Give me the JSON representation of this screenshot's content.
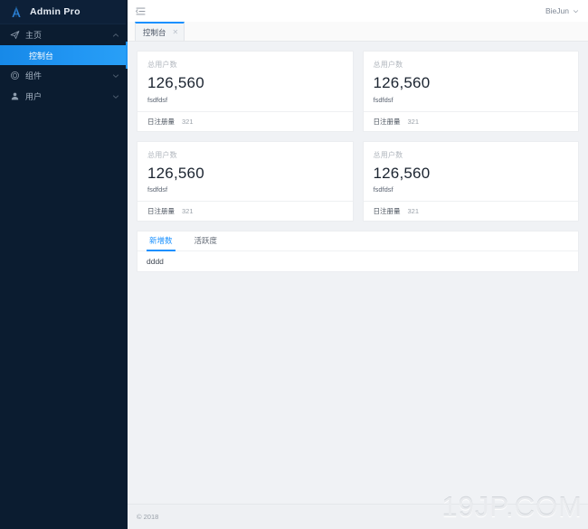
{
  "sidebar": {
    "brand": {
      "logo_icon": "letter-a-logo-icon",
      "title": "Admin Pro"
    },
    "items": [
      {
        "label": "主页",
        "icon": "send-plane-icon",
        "arrow": "chevron-up-icon",
        "expanded": true,
        "children": [
          {
            "label": "控制台",
            "active": true
          }
        ]
      },
      {
        "label": "组件",
        "icon": "box-component-icon",
        "arrow": "chevron-down-icon",
        "expanded": false,
        "children": []
      },
      {
        "label": "用户",
        "icon": "user-person-icon",
        "arrow": "chevron-down-icon",
        "expanded": false,
        "children": []
      }
    ]
  },
  "header": {
    "menu_fold_icon": "menu-fold-icon",
    "user_name": "BieJun",
    "user_chevron_icon": "chevron-down-icon"
  },
  "tabbar": {
    "tabs": [
      {
        "label": "控制台",
        "close_icon": "close-icon",
        "active": true
      }
    ]
  },
  "cards": [
    {
      "title": "总用户数",
      "value": "126,560",
      "sub": "fsdfdsf",
      "footer_label": "日注册量",
      "footer_value": "321"
    },
    {
      "title": "总用户数",
      "value": "126,560",
      "sub": "fsdfdsf",
      "footer_label": "日注册量",
      "footer_value": "321"
    },
    {
      "title": "总用户数",
      "value": "126,560",
      "sub": "fsdfdsf",
      "footer_label": "日注册量",
      "footer_value": "321"
    },
    {
      "title": "总用户数",
      "value": "126,560",
      "sub": "fsdfdsf",
      "footer_label": "日注册量",
      "footer_value": "321"
    }
  ],
  "panel": {
    "tabs": [
      {
        "label": "新增数",
        "active": true
      },
      {
        "label": "活跃度",
        "active": false
      }
    ],
    "body_text": "dddd"
  },
  "footer": {
    "copyright": "© 2018"
  },
  "watermark": {
    "text": "19JP.COM"
  },
  "colors": {
    "sidebar_bg": "#0b1c30",
    "sidebar_head_bg": "#0d2038",
    "accent_blue": "#1890ff",
    "active_menu_blue": "#2196f3",
    "content_bg": "#f0f2f5",
    "card_bg": "#ffffff",
    "value_text": "#1b2430",
    "muted_text": "#b0b6bd"
  }
}
